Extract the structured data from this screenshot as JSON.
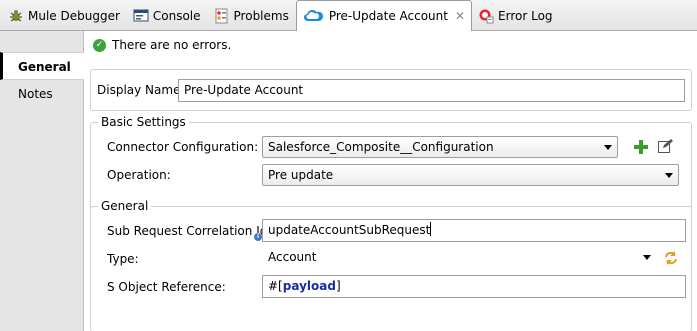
{
  "tabs": [
    {
      "label": "Mule Debugger",
      "icon": "debug-icon"
    },
    {
      "label": "Console",
      "icon": "console-icon"
    },
    {
      "label": "Problems",
      "icon": "problems-icon"
    },
    {
      "label": "Pre-Update Account",
      "icon": "salesforce-cloud-icon",
      "active": true,
      "close": "✕"
    },
    {
      "label": "Error Log",
      "icon": "error-log-icon"
    }
  ],
  "nav": {
    "items": [
      {
        "label": "General",
        "active": true
      },
      {
        "label": "Notes",
        "active": false
      }
    ]
  },
  "status": {
    "text": "There are no errors."
  },
  "display": {
    "label": "Display Name:",
    "value": "Pre-Update Account"
  },
  "basic": {
    "title": "Basic Settings",
    "connector_label": "Connector Configuration:",
    "connector_value": "Salesforce_Composite__Configuration",
    "operation_label": "Operation:",
    "operation_value": "Pre update"
  },
  "general": {
    "title": "General",
    "subreq_label": "Sub Request Correlation Id:",
    "subreq_value": "updateAccountSubRequest",
    "type_label": "Type:",
    "type_value": "Account",
    "sobj_label": "S Object Reference:",
    "sobj_prefix": "#[",
    "sobj_keyword": "payload",
    "sobj_suffix": "]"
  },
  "colors": {
    "accent": "#1c2c9c",
    "ok": "#3aa63a",
    "add": "#3c9c2c"
  }
}
